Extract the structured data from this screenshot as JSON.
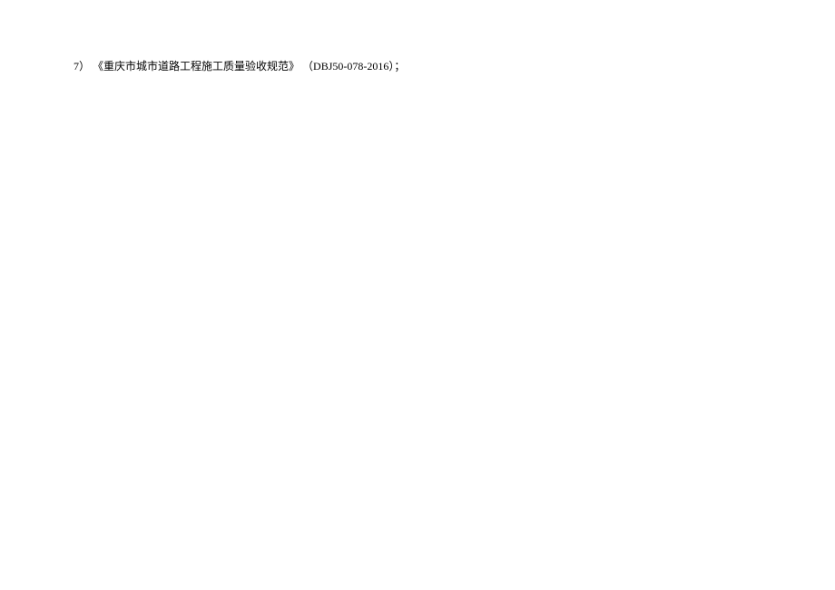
{
  "document": {
    "items": [
      {
        "number": "7）",
        "text": "《重庆市城市道路工程施工质量验收规范》",
        "code": "（DBJ50-078-2016）；"
      }
    ]
  }
}
